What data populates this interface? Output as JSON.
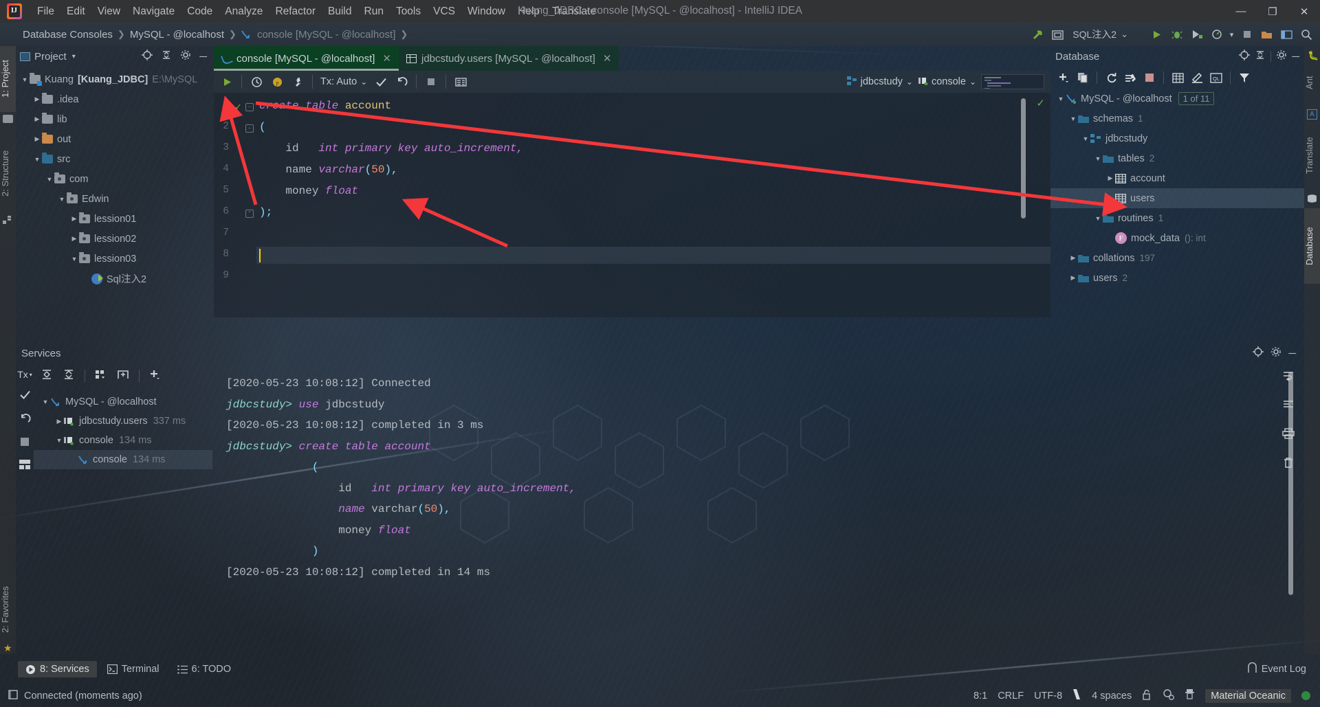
{
  "window": {
    "title": "Kuang_JDBC - console [MySQL - @localhost] - IntelliJ IDEA",
    "minimize": "—",
    "maximize": "❐",
    "close": "✕"
  },
  "menu": {
    "items": [
      "File",
      "Edit",
      "View",
      "Navigate",
      "Code",
      "Analyze",
      "Refactor",
      "Build",
      "Run",
      "Tools",
      "VCS",
      "Window",
      "Help",
      "Translate"
    ]
  },
  "breadcrumb": {
    "items": [
      "Database Consoles",
      "MySQL - @localhost",
      "console [MySQL - @localhost]"
    ],
    "separator": "❯"
  },
  "navbar_right": {
    "run_config": "SQL注入2",
    "dropdown_caret": "⌄",
    "icons": [
      "cursor-arrow-icon",
      "window-icon",
      "run-icon",
      "debug-icon",
      "coverage-icon",
      "profile-icon",
      "stop-icon",
      "open-folder-icon",
      "layout-icon",
      "search-icon"
    ]
  },
  "left_strip": {
    "tabs": [
      "1: Project",
      "2: Structure"
    ]
  },
  "right_strip": {
    "tabs": [
      "Ant",
      "Translate",
      "Database"
    ]
  },
  "project": {
    "title": "Project",
    "tree": [
      {
        "label": "Kuang",
        "bold": "[Kuang_JDBC]",
        "path": "E:\\MySQL",
        "indent": 0,
        "arrow": "▼",
        "icon": "module-folder"
      },
      {
        "label": ".idea",
        "indent": 1,
        "arrow": "▶",
        "icon": "folder-grey"
      },
      {
        "label": "lib",
        "indent": 1,
        "arrow": "▶",
        "icon": "folder-grey"
      },
      {
        "label": "out",
        "indent": 1,
        "arrow": "▶",
        "icon": "folder-orange"
      },
      {
        "label": "src",
        "indent": 1,
        "arrow": "▼",
        "icon": "folder-blue"
      },
      {
        "label": "com",
        "indent": 2,
        "arrow": "▼",
        "icon": "package"
      },
      {
        "label": "Edwin",
        "indent": 3,
        "arrow": "▼",
        "icon": "package"
      },
      {
        "label": "lession01",
        "indent": 4,
        "arrow": "▶",
        "icon": "package"
      },
      {
        "label": "lession02",
        "indent": 4,
        "arrow": "▶",
        "icon": "package"
      },
      {
        "label": "lession03",
        "indent": 4,
        "arrow": "▼",
        "icon": "package"
      },
      {
        "label": "Sql注入2",
        "indent": 5,
        "arrow": "",
        "icon": "java-class"
      }
    ]
  },
  "editor": {
    "tabs": [
      {
        "label": "console [MySQL - @localhost]",
        "icon": "console-icon",
        "active": true,
        "close": "✕"
      },
      {
        "label": "jdbcstudy.users [MySQL - @localhost]",
        "icon": "table-icon",
        "active": false,
        "close": "✕"
      }
    ],
    "toolbar": {
      "run_icon": "run-icon",
      "history_icon": "history-icon",
      "pending_icon": "pending-icon",
      "settings_icon": "wrench-icon",
      "tx_label": "Tx: Auto",
      "tx_caret": "⌄",
      "commit_icon": "commit-check-icon",
      "rollback_icon": "rollback-icon",
      "stop_icon": "stop-icon",
      "output_icon": "output-icon",
      "schema": "jdbcstudy",
      "schema_caret": "⌄",
      "session": "console",
      "session_caret": "⌄"
    },
    "gutter_ok": "✓",
    "lines": [
      {
        "n": "1",
        "tokens": [
          {
            "t": "create table ",
            "c": "k"
          },
          {
            "t": "account",
            "c": "id"
          }
        ]
      },
      {
        "n": "2",
        "tokens": [
          {
            "t": "(",
            "c": "punct"
          }
        ]
      },
      {
        "n": "3",
        "tokens": [
          {
            "t": "    id   ",
            "c": "pl"
          },
          {
            "t": "int primary key auto_increment,",
            "c": "k"
          }
        ]
      },
      {
        "n": "4",
        "tokens": [
          {
            "t": "    name ",
            "c": "pl"
          },
          {
            "t": "varchar",
            "c": "k"
          },
          {
            "t": "(",
            "c": "punct"
          },
          {
            "t": "50",
            "c": "num"
          },
          {
            "t": "),",
            "c": "punct"
          }
        ]
      },
      {
        "n": "5",
        "tokens": [
          {
            "t": "    money ",
            "c": "pl"
          },
          {
            "t": "float",
            "c": "k"
          }
        ]
      },
      {
        "n": "6",
        "tokens": [
          {
            "t": ");",
            "c": "punct"
          }
        ]
      },
      {
        "n": "7",
        "tokens": []
      },
      {
        "n": "8",
        "tokens": []
      },
      {
        "n": "9",
        "tokens": []
      }
    ]
  },
  "database": {
    "title": "Database",
    "header_icons": [
      "locate-icon",
      "collapse-all-icon",
      "gear-icon",
      "hide-icon"
    ],
    "toolbar_icons": [
      "add-icon",
      "copy-icon",
      "refresh-icon",
      "sync-icon",
      "stop-icon",
      "table-editor-icon",
      "edit-icon",
      "query-console-icon",
      "filter-icon"
    ],
    "tree": [
      {
        "label": "MySQL - @localhost",
        "indent": 0,
        "arrow": "▼",
        "icon": "datasource-icon",
        "badge": "1 of 11"
      },
      {
        "label": "schemas",
        "indent": 1,
        "arrow": "▼",
        "icon": "folder-blue",
        "count": "1"
      },
      {
        "label": "jdbcstudy",
        "indent": 2,
        "arrow": "▼",
        "icon": "schema-icon"
      },
      {
        "label": "tables",
        "indent": 3,
        "arrow": "▼",
        "icon": "folder-blue",
        "count": "2"
      },
      {
        "label": "account",
        "indent": 4,
        "arrow": "▶",
        "icon": "table-icon"
      },
      {
        "label": "users",
        "indent": 4,
        "arrow": "▶",
        "icon": "table-icon",
        "selected": true
      },
      {
        "label": "routines",
        "indent": 3,
        "arrow": "▼",
        "icon": "folder-blue",
        "count": "1"
      },
      {
        "label": "mock_data",
        "indent": 4,
        "arrow": "",
        "icon": "function-icon",
        "count": "(): int"
      },
      {
        "label": "collations",
        "indent": 1,
        "arrow": "▶",
        "icon": "folder-blue",
        "count": "197"
      },
      {
        "label": "users",
        "indent": 1,
        "arrow": "▶",
        "icon": "folder-blue",
        "count": "2"
      }
    ]
  },
  "services": {
    "title": "Services",
    "header_icons": [
      "locate-icon",
      "gear-icon",
      "hide-icon"
    ],
    "toolbar_icons": [
      "tx-icon",
      "expand-all-icon",
      "collapse-all-icon",
      "group-icon",
      "new-tab-icon",
      "add-icon"
    ],
    "side_icons": [
      "commit-check-icon",
      "rollback-icon",
      "stop-icon",
      "layout-icon"
    ],
    "right_icons": [
      "wrap-icon",
      "scroll-end-icon",
      "print-icon",
      "trash-icon"
    ],
    "tree": [
      {
        "label": "MySQL - @localhost",
        "indent": 0,
        "arrow": "▼",
        "icon": "datasource-icon"
      },
      {
        "label": "jdbcstudy.users",
        "indent": 1,
        "arrow": "▶",
        "icon": "session-icon",
        "ms": "337 ms"
      },
      {
        "label": "console",
        "indent": 1,
        "arrow": "▼",
        "icon": "session-icon",
        "ms": "134 ms"
      },
      {
        "label": "console",
        "indent": 2,
        "arrow": "",
        "icon": "console-icon",
        "ms": "134 ms",
        "selected": true
      }
    ],
    "console_lines": [
      [
        {
          "t": "[2020-05-23 10:08:12] Connected",
          "c": "pl"
        }
      ],
      [
        {
          "t": "jdbcstudy> ",
          "c": "cprompt"
        },
        {
          "t": "use ",
          "c": "k"
        },
        {
          "t": "jdbcstudy",
          "c": "pl"
        }
      ],
      [
        {
          "t": "[2020-05-23 10:08:12] completed in 3 ms",
          "c": "pl"
        }
      ],
      [
        {
          "t": "jdbcstudy> ",
          "c": "cprompt"
        },
        {
          "t": "create table account",
          "c": "k"
        }
      ],
      [
        {
          "t": "             (",
          "c": "punct"
        }
      ],
      [
        {
          "t": "                 id   ",
          "c": "pl"
        },
        {
          "t": "int primary key auto_increment,",
          "c": "k"
        }
      ],
      [
        {
          "t": "                 ",
          "c": "pl"
        },
        {
          "t": "name ",
          "c": "k"
        },
        {
          "t": "varchar",
          "c": "pl"
        },
        {
          "t": "(",
          "c": "punct"
        },
        {
          "t": "50",
          "c": "num"
        },
        {
          "t": "),",
          "c": "punct"
        }
      ],
      [
        {
          "t": "                 money ",
          "c": "pl"
        },
        {
          "t": "float",
          "c": "k"
        }
      ],
      [
        {
          "t": "             )",
          "c": "punct"
        }
      ],
      [
        {
          "t": "[2020-05-23 10:08:12] completed in 14 ms",
          "c": "pl"
        }
      ]
    ]
  },
  "toolwindow_bar": {
    "items": [
      {
        "label": "8: Services",
        "underline": "8",
        "icon": "services-icon",
        "active": true
      },
      {
        "label": "Terminal",
        "icon": "terminal-icon",
        "active": false
      },
      {
        "label": "6: TODO",
        "underline": "6",
        "icon": "todo-icon",
        "active": false
      }
    ],
    "event_log": "Event Log"
  },
  "status_bar": {
    "connection": "Connected (moments ago)",
    "caret_pos": "8:1",
    "line_sep": "CRLF",
    "encoding": "UTF-8",
    "indent": "4 spaces",
    "theme": "Material Oceanic",
    "icons": [
      "lock-open-icon",
      "inspections-icon",
      "hector-icon"
    ]
  },
  "colors": {
    "accent_green": "#0b4023",
    "arrow_red": "#f4373a",
    "keyword": "#c679dd",
    "identifier": "#e5c07b",
    "number": "#f78c6c",
    "punct": "#89ddff"
  }
}
